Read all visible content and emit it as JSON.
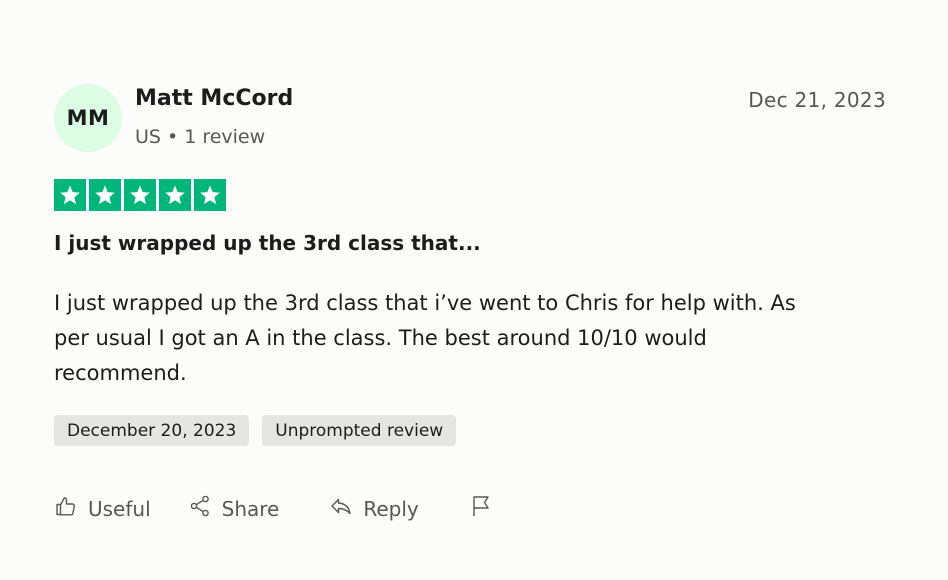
{
  "reviewer": {
    "initials": "MM",
    "name": "Matt McCord",
    "country": "US",
    "separator": "•",
    "reviews": "1 review",
    "avatar_bg": "#dcfce3"
  },
  "review": {
    "date": "Dec 21, 2023",
    "rating": 5,
    "rating_max": 5,
    "star_color": "#00b67a",
    "title": "I just wrapped up the 3rd class that...",
    "body": "I just wrapped up the 3rd class that i’ve went to Chris for help with. As per usual I got an A in the class. The best around 10/10 would recommend.",
    "tags": [
      "December 20, 2023",
      "Unprompted review"
    ]
  },
  "actions": {
    "useful": "Useful",
    "share": "Share",
    "reply": "Reply",
    "icons": [
      "thumbs-up-icon",
      "share-icon",
      "reply-icon",
      "flag-icon"
    ]
  }
}
